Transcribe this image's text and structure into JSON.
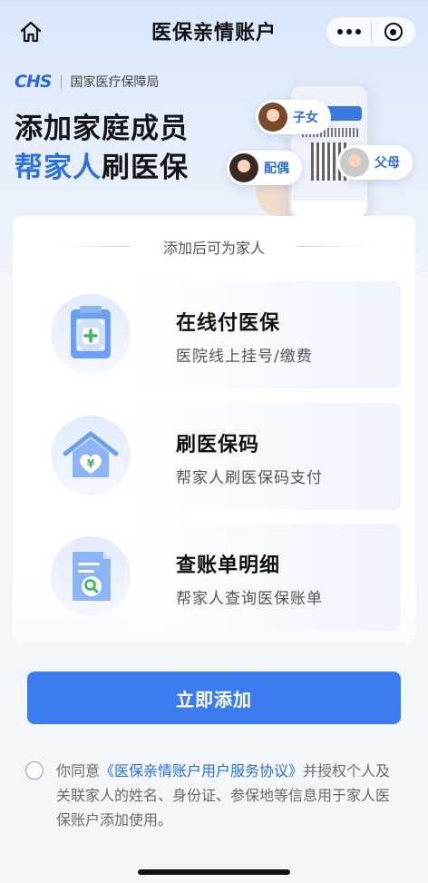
{
  "nav": {
    "title": "医保亲情账户",
    "home_icon": "home-icon",
    "more_icon": "more-dots-icon",
    "close_icon": "target-icon"
  },
  "brand": {
    "logo": "CHS",
    "org_name": "国家医疗保障局"
  },
  "hero": {
    "line1": "添加家庭成员",
    "line2_highlight": "帮家人",
    "line2_rest": "刷医保",
    "chips": {
      "child": "子女",
      "spouse": "配偶",
      "parents": "父母"
    }
  },
  "card": {
    "heading": "添加后可为家人",
    "features": [
      {
        "title": "在线付医保",
        "subtitle": "医院线上挂号/缴费",
        "icon": "hospital-plus-icon"
      },
      {
        "title": "刷医保码",
        "subtitle": "帮家人刷医保码支付",
        "icon": "house-yuan-icon"
      },
      {
        "title": "查账单明细",
        "subtitle": "帮家人查询医保账单",
        "icon": "bill-search-icon"
      }
    ]
  },
  "actions": {
    "add_label": "立即添加"
  },
  "agreement": {
    "prefix": "你同意",
    "link": "《医保亲情账户用户服务协议》",
    "suffix": "并授权个人及关联家人的姓名、身份证、参保地等信息用于家人医保账户添加使用。"
  },
  "colors": {
    "accent": "#3b7cf0",
    "brand_blue": "#2f6fe4",
    "background": "#f3f6fb"
  }
}
